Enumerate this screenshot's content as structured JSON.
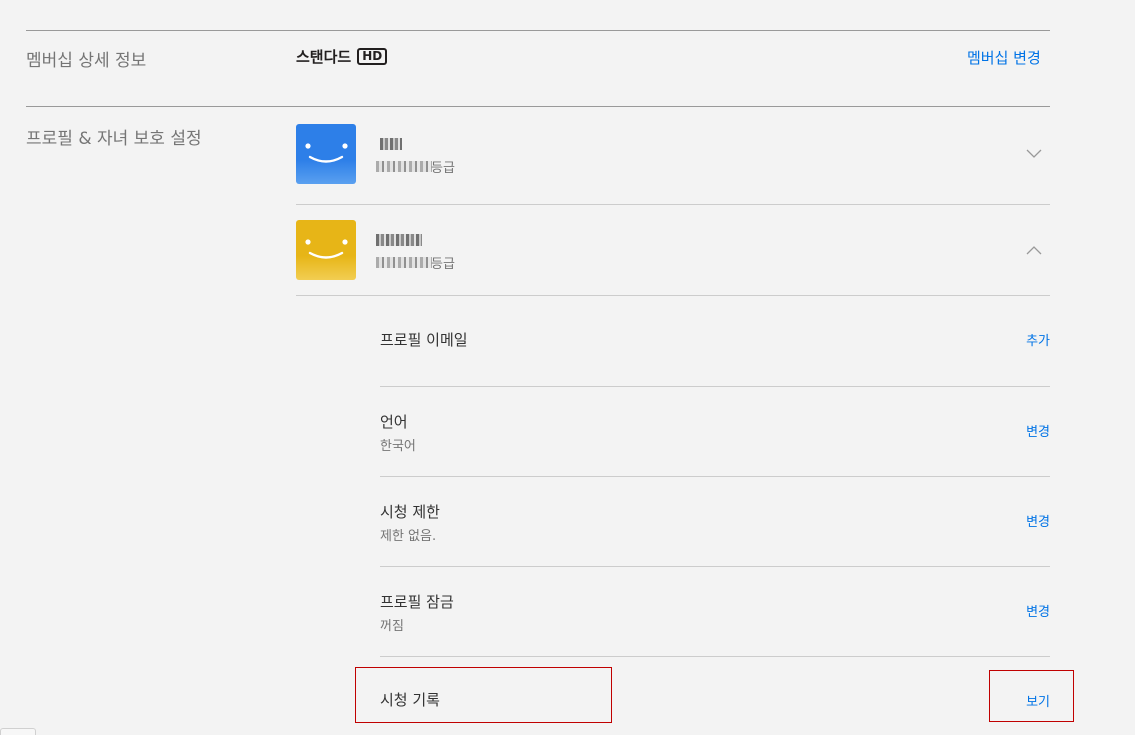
{
  "membership": {
    "label": "멤버십 상세 정보",
    "plan": "스탠다드",
    "badge": "HD",
    "change_link": "멤버십 변경"
  },
  "profiles_section": {
    "label": "프로필 & 자녀 보호 설정",
    "profiles": [
      {
        "rating_suffix": "등급",
        "avatar_color": "#2d7fe8",
        "state": "collapsed"
      },
      {
        "rating_suffix": "등급",
        "avatar_color": "#e7b517",
        "state": "expanded"
      }
    ]
  },
  "settings": [
    {
      "title": "프로필 이메일",
      "sub": "",
      "action": "추가"
    },
    {
      "title": "언어",
      "sub": "한국어",
      "action": "변경"
    },
    {
      "title": "시청 제한",
      "sub": "제한 없음.",
      "action": "변경"
    },
    {
      "title": "프로필 잠금",
      "sub": "꺼짐",
      "action": "변경"
    },
    {
      "title": "시청 기록",
      "sub": "",
      "action": "보기"
    }
  ]
}
